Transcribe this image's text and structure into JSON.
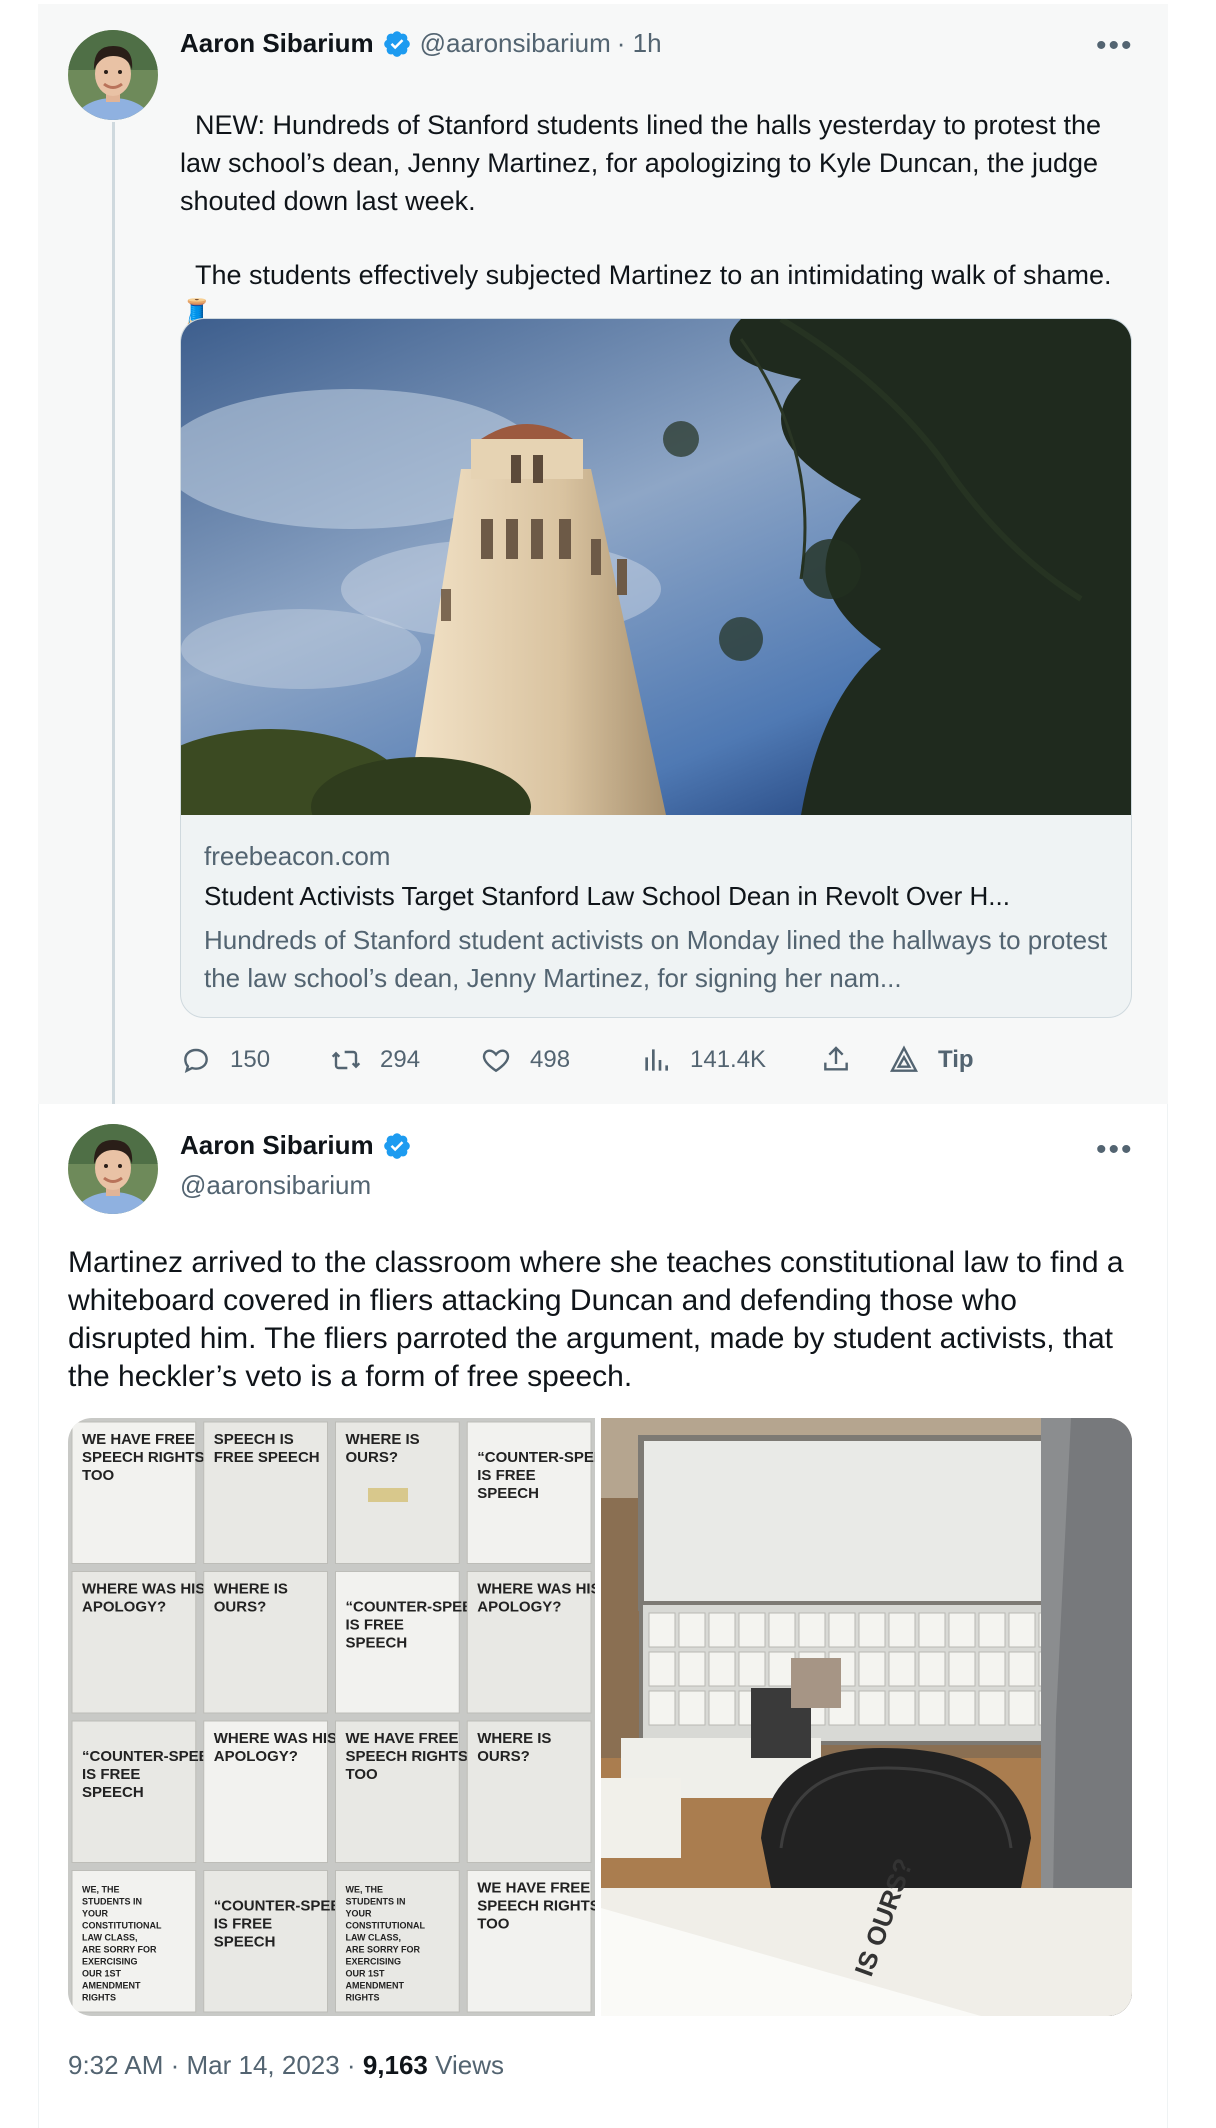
{
  "colors": {
    "background": "#ffffff",
    "thread_background": "#f7f8f8",
    "text": "#0f1419",
    "secondary_text": "#536471",
    "verified_blue": "#1d9bf0",
    "border": "#cfd9de"
  },
  "tweet1": {
    "author": {
      "name": "Aaron Sibarium",
      "handle": "@aaronsibarium",
      "time": "· 1h",
      "verified": true
    },
    "more_icon": "ellipsis-icon",
    "text_p1": "NEW: Hundreds of Stanford students lined the halls yesterday to protest the law school’s dean, Jenny Martinez, for apologizing to Kyle Duncan, the judge shouted down last week.",
    "text_p2": "The students effectively subjected Martinez to an intimidating walk of shame.",
    "thread_emoji": "🧵",
    "link_card": {
      "image_alt": "Hoover Tower at Stanford against a blue sky with tree branches",
      "domain": "freebeacon.com",
      "title": "Student Activists Target Stanford Law School Dean in Revolt Over H...",
      "description": "Hundreds of Stanford student activists on Monday lined the hallways to protest the law school’s dean, Jenny Martinez, for signing her nam..."
    },
    "actions": {
      "replies": "150",
      "retweets": "294",
      "likes": "498",
      "views": "141.4K",
      "tip": "Tip"
    }
  },
  "tweet2": {
    "author": {
      "name": "Aaron Sibarium",
      "handle": "@aaronsibarium",
      "verified": true
    },
    "more_icon": "ellipsis-icon",
    "text": "Martinez arrived to the classroom where she teaches constitutional law to find a whiteboard covered in fliers attacking Duncan and defending those who disrupted him. The fliers parroted the argument, made by student activists, that the heckler’s veto is a form of free speech.",
    "images": [
      {
        "alt": "Whiteboard covered in printed fliers",
        "fliers": [
          "WE HAVE FREE SPEECH RIGHTS TOO",
          "SPEECH IS FREE SPEECH",
          "WHERE IS OURS?",
          "“COUNTER-SPEECH” IS FREE SPEECH",
          "WHERE WAS HIS APOLOGY?",
          "WHERE IS OURS?",
          "“COUNTER-SPEECH” IS FREE SPEECH",
          "WHERE WAS HIS APOLOGY?",
          "“COUNTER-SPEECH” IS FREE SPEECH",
          "WHERE WAS HIS APOLOGY?",
          "WE HAVE FREE SPEECH RIGHTS TOO",
          "WHERE IS OURS?",
          "WE, THE STUDENTS IN YOUR CONSTITUTIONAL LAW CLASS, ARE SORRY FOR EXERCISING OUR 1ST AMENDMENT RIGHTS",
          "“COUNTER-SPEECH” IS FREE SPEECH",
          "WE, THE STUDENTS IN YOUR CONSTITUTIONAL LAW CLASS, ARE SORRY FOR EXERCISING OUR 1ST AMENDMENT RIGHTS",
          "WE HAVE FREE SPEECH RIGHTS TOO"
        ]
      },
      {
        "alt": "Classroom with whiteboard covered in fliers and a lectern"
      }
    ],
    "timestamp": "9:32 AM · Mar 14, 2023 ·",
    "views_count": "9,163",
    "views_label": "Views"
  }
}
